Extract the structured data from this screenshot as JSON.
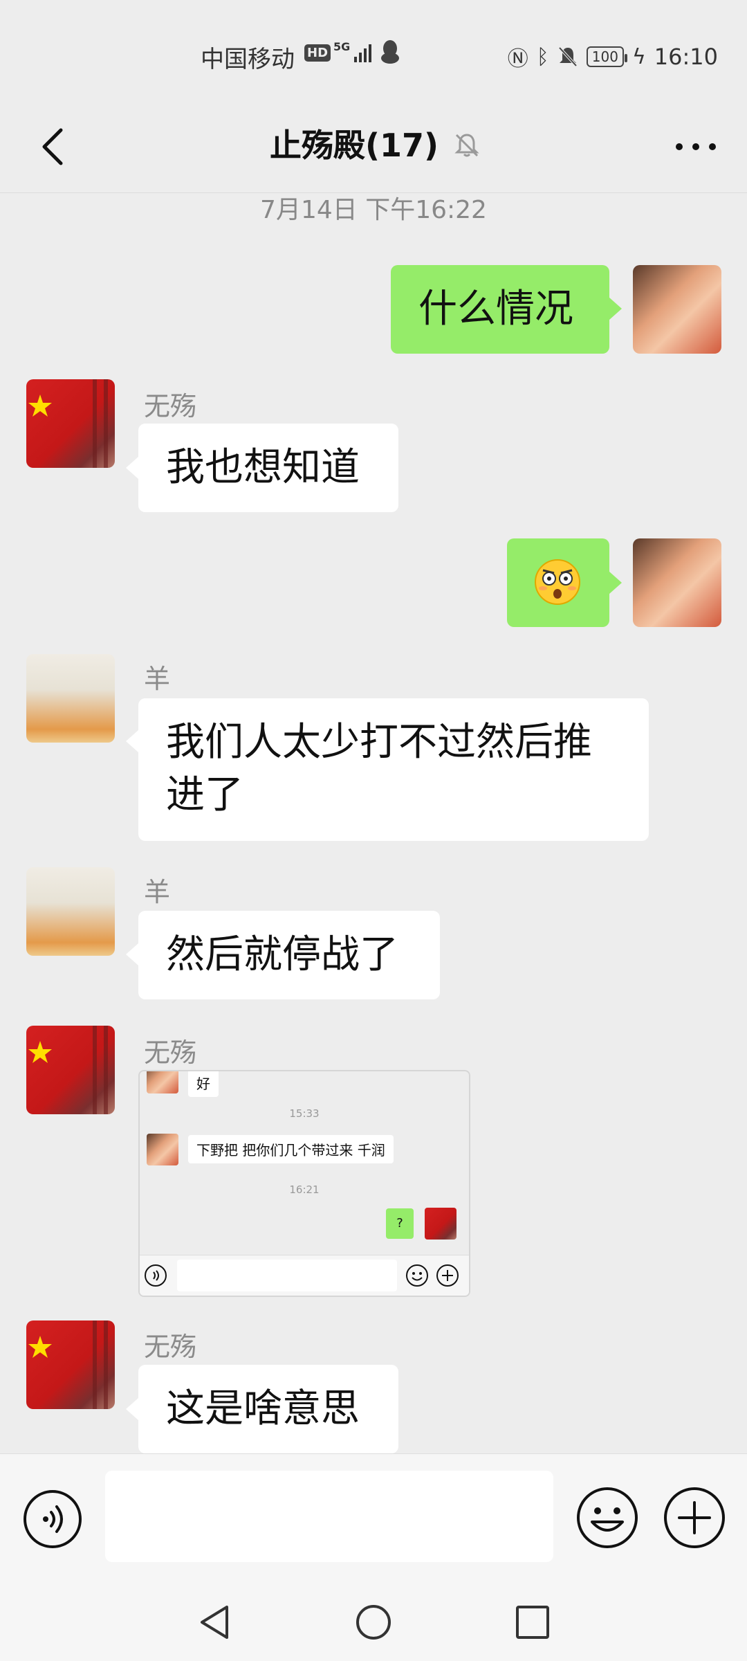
{
  "status_bar": {
    "carrier": "中国移动",
    "hd": "HD",
    "network": "5G",
    "battery": "100",
    "time": "16:10"
  },
  "header": {
    "title": "止殇殿(17)"
  },
  "timestamp": "7月14日 下午16:22",
  "messages": [
    {
      "side": "right",
      "text": "什么情况"
    },
    {
      "side": "left",
      "sender": "无殇",
      "text": "我也想知道"
    },
    {
      "side": "right",
      "emoji": "astonished-face"
    },
    {
      "side": "left",
      "sender": "羊",
      "text_line1": "我们人太少打不过然后推",
      "text_line2": "进了"
    },
    {
      "side": "left",
      "sender": "羊",
      "text": "然后就停战了"
    },
    {
      "side": "left",
      "sender": "无殇",
      "image": {
        "top_bubble": "好",
        "time1": "15:33",
        "bubble2": "下野把  把你们几个带过来  千润",
        "time2": "16:21",
        "green_bubble": "?"
      }
    },
    {
      "side": "left",
      "sender": "无殇",
      "text": "这是啥意思"
    }
  ],
  "input": {
    "placeholder": ""
  },
  "icons": {
    "back": "back-arrow-icon",
    "mute": "bell-off-icon",
    "more": "more-dots-icon",
    "voice": "voice-icon",
    "emoji": "emoji-icon",
    "plus": "plus-icon"
  },
  "colors": {
    "background": "#ededed",
    "green_bubble": "#95ec69",
    "white_bubble": "#ffffff"
  }
}
